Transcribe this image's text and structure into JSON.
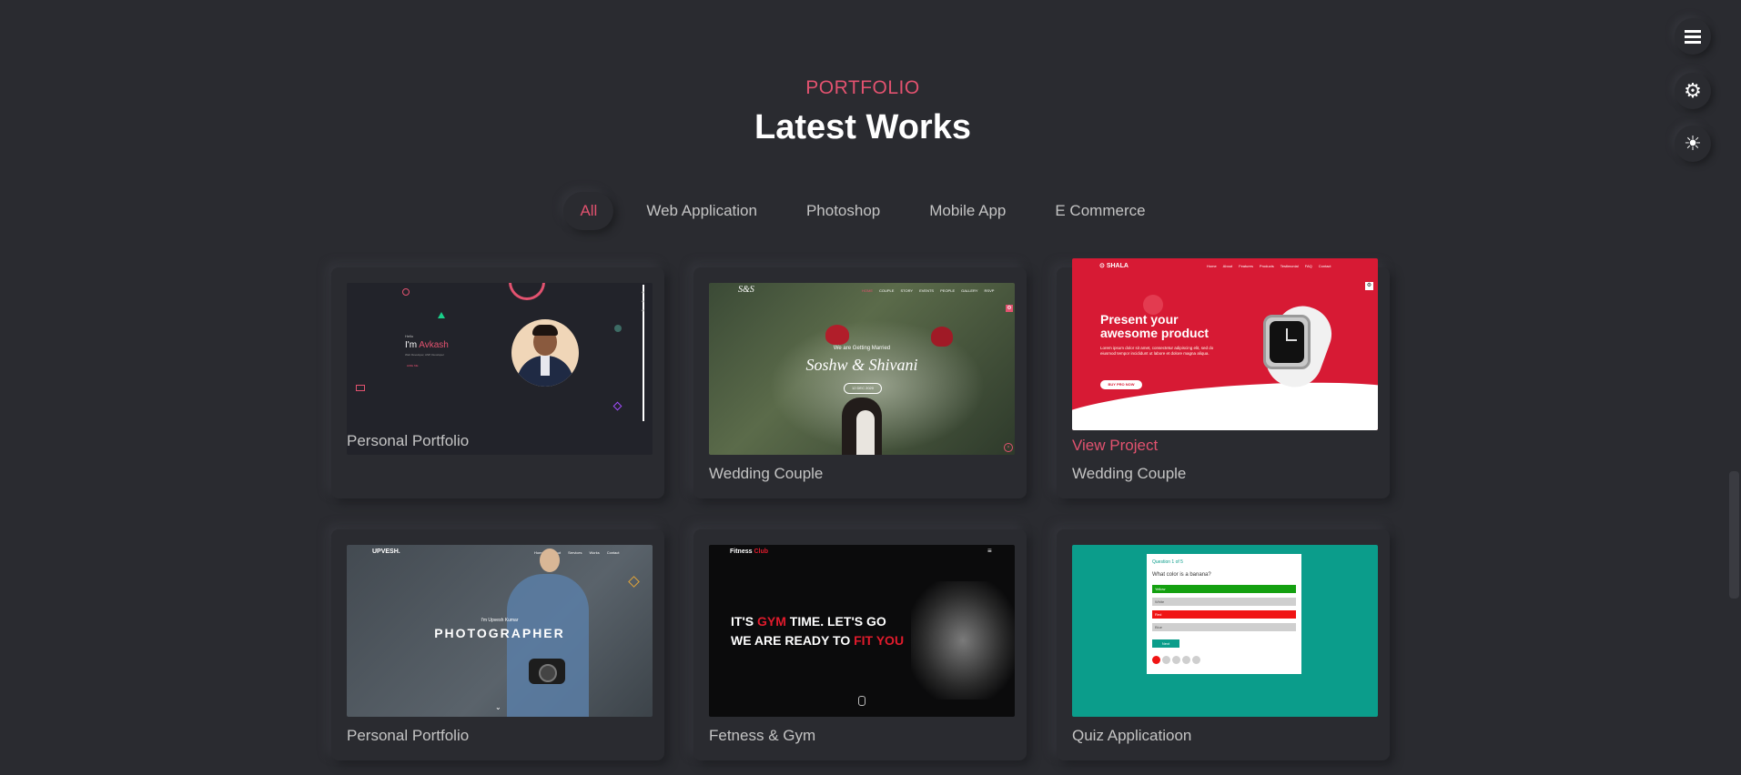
{
  "section": {
    "subtitle": "PORTFOLIO",
    "title": "Latest Works"
  },
  "filters": [
    "All",
    "Web Application",
    "Photoshop",
    "Mobile App",
    "E Commerce"
  ],
  "cards": [
    {
      "title": "Personal Portfolio",
      "thumb": {
        "greeting": "Hello",
        "name_prefix": "I'm ",
        "name": "Avkash",
        "tagline": "Web Developer, ASP, Developer",
        "cta": "HIRE ME"
      }
    },
    {
      "title": "Wedding Couple",
      "thumb": {
        "logo": "S&S",
        "nav": [
          "HOME",
          "COUPLE",
          "STORY",
          "EVENTS",
          "PEOPLE",
          "GALLERY",
          "RSVP"
        ],
        "kicker": "We are Getting Married",
        "names": "Soshw & Shivani",
        "date": "12 DEC 2020"
      }
    },
    {
      "title": "Wedding Couple",
      "link": "View Project",
      "thumb": {
        "logo": "SHALA",
        "nav": [
          "Home",
          "About",
          "Features",
          "Products",
          "Testimonial",
          "FAQ",
          "Contact"
        ],
        "headline": "Present your awesome product",
        "body": "Lorem ipsum dolor sit amet, consectetur adipiscing elit, sed do eiusmod tempor incididunt ut labore et dolore magna aliqua.",
        "cta": "BUY PRO NOW"
      }
    },
    {
      "title": "Personal Portfolio",
      "thumb": {
        "logo": "UPVESH.",
        "nav": [
          "Home",
          "About",
          "Services",
          "Works",
          "Contact"
        ],
        "kicker": "I'm Upvesh Kumar",
        "headline": "PHOTOGRAPHER"
      }
    },
    {
      "title": "Fetness & Gym",
      "thumb": {
        "logo_a": "Fitness ",
        "logo_b": "Club",
        "line1_a": "IT'S ",
        "line1_b": "GYM",
        "line1_c": " TIME. LET'S GO",
        "line2_a": "WE ARE READY TO ",
        "line2_b": "FIT YOU"
      }
    },
    {
      "title": "Quiz Applicatioon",
      "thumb": {
        "counter": "Question 1 of 5",
        "question": "What color is a banana?",
        "options": [
          "Yellow",
          "White",
          "Red",
          "Blue"
        ],
        "button": "Next"
      }
    }
  ],
  "side_buttons": [
    "menu-icon",
    "gear-icon",
    "sun-icon"
  ],
  "colors": {
    "accent": "#e2526f",
    "background": "#2a2b30",
    "product_red": "#d71a34",
    "quiz_teal": "#0b9d8b"
  }
}
